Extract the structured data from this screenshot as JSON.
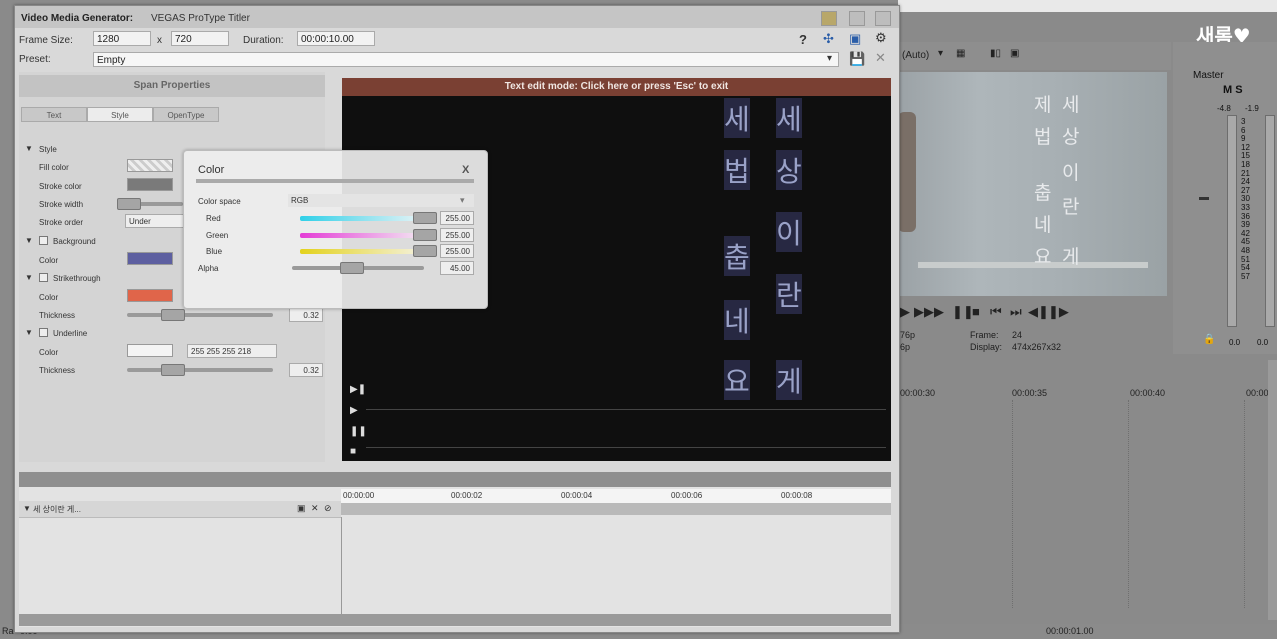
{
  "bg": {
    "logo": "새롬♥",
    "preview_toolbar": "(Auto)",
    "master_label": "Master",
    "master_msm": "M S",
    "db_left": "-4.8",
    "db_right": "-1.9",
    "meter_scale": [
      "3",
      "6",
      "9",
      "12",
      "15",
      "18",
      "21",
      "24",
      "27",
      "30",
      "33",
      "36",
      "39",
      "42",
      "45",
      "48",
      "51",
      "54",
      "57"
    ],
    "meter_bottom_left": "0.0",
    "meter_bottom_right": "0.0",
    "preview_text_col1": [
      "제",
      "법",
      "춥",
      "네",
      "요"
    ],
    "preview_text_col2": [
      "세",
      "상",
      "이",
      "란",
      "게"
    ],
    "info_fmt1": "76p",
    "info_fmt2": "6p",
    "frame_label": "Frame:",
    "frame_value": "24",
    "display_label": "Display:",
    "display_value": "474x267x32",
    "ruler_ticks": [
      "00:00:30",
      "00:00:35",
      "00:00:40",
      "00:00"
    ],
    "bottom_left": "Ra",
    "bottom_left2": "0:00",
    "bottom_time": "00:00:01.00"
  },
  "dialog": {
    "title_bold": "Video Media Generator:",
    "title_plugin": "VEGAS ProType Titler",
    "frame_size_label": "Frame Size:",
    "frame_w": "1280",
    "frame_x": "x",
    "frame_h": "720",
    "duration_label": "Duration:",
    "duration_value": "00:00:10.00",
    "preset_label": "Preset:",
    "preset_value": "Empty"
  },
  "panel": {
    "heading": "Span Properties",
    "tabs": [
      "Text",
      "Style",
      "OpenType"
    ],
    "style_section": "Style",
    "fill_color": "Fill color",
    "stroke_color": "Stroke color",
    "stroke_width": "Stroke width",
    "stroke_order": "Stroke order",
    "stroke_order_value": "Under",
    "background": "Background",
    "bg_color": "Color",
    "strikethrough": "Strikethrough",
    "strike_color": "Color",
    "strike_thickness": "Thickness",
    "strike_thickness_value": "0.32",
    "underline": "Underline",
    "underline_color": "Color",
    "underline_color_value": "255 255 255 218",
    "underline_thickness": "Thickness",
    "underline_thickness_value": "0.32"
  },
  "preview": {
    "banner": "Text edit mode: Click here or press 'Esc' to exit",
    "col1": [
      "세",
      "법",
      "",
      "춥",
      "네",
      "요"
    ],
    "col2": [
      "세",
      "상",
      "이",
      "",
      "란",
      "게"
    ]
  },
  "color_popup": {
    "title": "Color",
    "close": "X",
    "colorspace_label": "Color space",
    "colorspace_value": "RGB",
    "red_label": "Red",
    "red_value": "255.00",
    "green_label": "Green",
    "green_value": "255.00",
    "blue_label": "Blue",
    "blue_value": "255.00",
    "alpha_label": "Alpha",
    "alpha_value": "45.00"
  },
  "timeline": {
    "track_name": "세 상이란 게...",
    "ticks": [
      "00:00:00",
      "00:00:02",
      "00:00:04",
      "00:00:06",
      "00:00:08"
    ]
  },
  "colors": {
    "banner": "#7a4033",
    "stroke_swatch": "#7a7a7a",
    "strike_swatch": "#e0654a",
    "bg_swatch": "#5d5fa0"
  }
}
